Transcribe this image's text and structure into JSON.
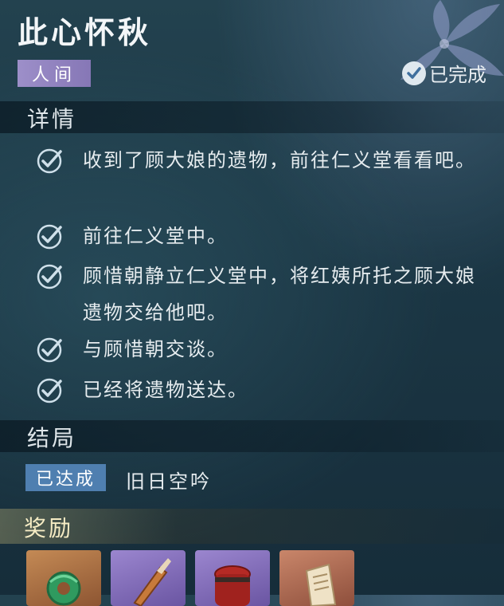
{
  "quest": {
    "title": "此心怀秋",
    "category": "人间",
    "status": "已完成",
    "status_icon": "check-circle-icon"
  },
  "details": {
    "heading": "详情",
    "objectives": [
      {
        "text": "收到了顾大娘的遗物，前往仁义堂看看吧。",
        "done": true
      },
      {
        "text": "前往仁义堂中。",
        "done": true
      },
      {
        "text": "顾惜朝静立仁义堂中，将红姨所托之顾大娘遗物交给他吧。",
        "done": true
      },
      {
        "text": "与顾惜朝交谈。",
        "done": true
      },
      {
        "text": "已经将遗物送达。",
        "done": true
      }
    ]
  },
  "ending": {
    "heading": "结局",
    "tag": "已达成",
    "name": "旧日空吟"
  },
  "rewards": {
    "heading": "奖励",
    "items": [
      {
        "icon": "jade-pendant-icon",
        "rarity_color": "#b87a4a"
      },
      {
        "icon": "feather-quill-icon",
        "rarity_color": "#8a6fc0"
      },
      {
        "icon": "red-jar-icon",
        "rarity_color": "#8a6fc0"
      },
      {
        "icon": "paper-scroll-icon",
        "rarity_color": "#b0705a"
      }
    ]
  },
  "colors": {
    "background": "#1b3644",
    "category_tag": "#9d8fc9",
    "ending_tag": "#4f7fb0",
    "reward_heading": "#f6ecc4"
  }
}
